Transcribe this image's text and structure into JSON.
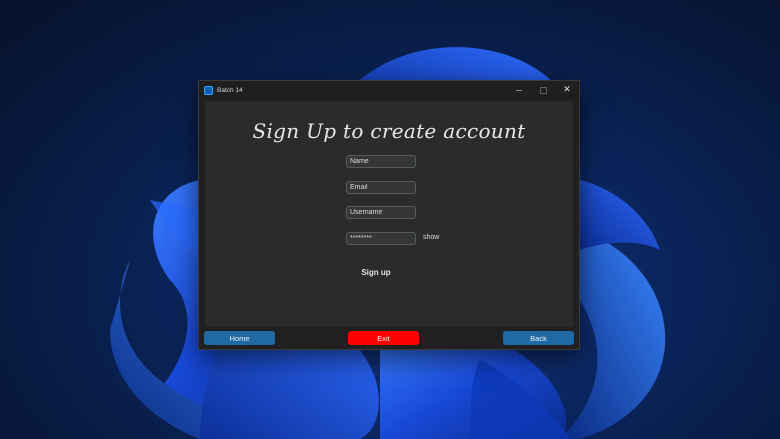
{
  "window": {
    "title": "Batch 14",
    "controls": {
      "minimize_icon": "minimize-icon",
      "maximize_icon": "maximize-icon",
      "close_icon": "close-icon",
      "close_glyph": "✕"
    }
  },
  "form": {
    "heading": "Sign Up to create account",
    "name_value": "Name",
    "email_value": "Email",
    "username_value": "Username",
    "password_value": "********",
    "show_label": "show",
    "signup_label": "Sign up"
  },
  "footer": {
    "home_label": "Home",
    "exit_label": "Exit",
    "back_label": "Back"
  },
  "colors": {
    "home_button": "#1f6aa5",
    "exit_button": "#ff0000",
    "back_button": "#1f6aa5",
    "window_bg": "#202020",
    "panel_bg": "#2b2b2b"
  }
}
